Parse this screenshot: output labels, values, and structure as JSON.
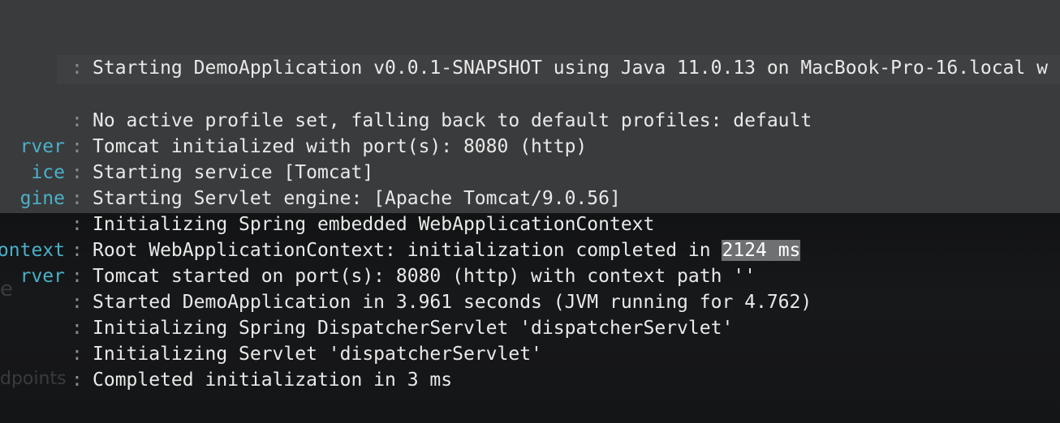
{
  "background_ghost": {
    "endpoints_label": "dpoints",
    "partial_letter": "e"
  },
  "log": {
    "lines": [
      {
        "logger": "",
        "message": "Starting DemoApplication v0.0.1-SNAPSHOT using Java 11.0.13 on MacBook-Pro-16.local w"
      },
      {
        "logger": "",
        "message": "No active profile set, falling back to default profiles: default"
      },
      {
        "logger": "rver",
        "message": "Tomcat initialized with port(s): 8080 (http)"
      },
      {
        "logger": "ice",
        "message": "Starting service [Tomcat]"
      },
      {
        "logger": "gine",
        "message": "Starting Servlet engine: [Apache Tomcat/9.0.56]"
      },
      {
        "logger": "",
        "message": "Initializing Spring embedded WebApplicationContext"
      },
      {
        "logger": "ontext",
        "message_prefix": "Root WebApplicationContext: initialization completed in ",
        "highlight": "2124 ms"
      },
      {
        "logger": "rver",
        "message": "Tomcat started on port(s): 8080 (http) with context path ''"
      },
      {
        "logger": "",
        "message": "Started DemoApplication in 3.961 seconds (JVM running for 4.762)"
      },
      {
        "logger": "",
        "message": "Initializing Spring DispatcherServlet 'dispatcherServlet'"
      },
      {
        "logger": "",
        "message": "Initializing Servlet 'dispatcherServlet'"
      },
      {
        "logger": "",
        "message": "Completed initialization in 3 ms"
      }
    ],
    "separator": ":"
  },
  "colors": {
    "logger": "#4ab0c8",
    "message": "#e9e9e9",
    "separator": "#8a8c8f",
    "selection": "#6f7072",
    "panel_top": "#3a3b3d",
    "panel_bottom": "#151617"
  }
}
